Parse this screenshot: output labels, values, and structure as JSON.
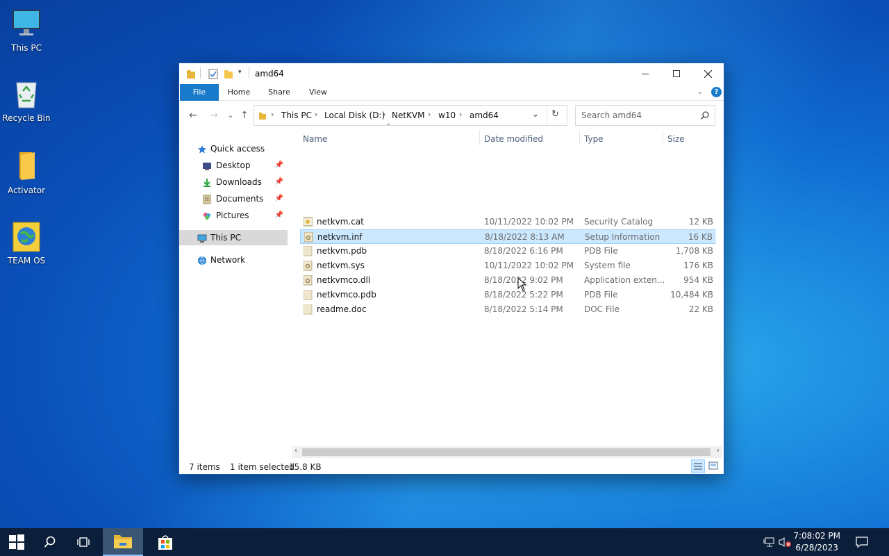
{
  "desktop": {
    "icons": [
      {
        "label": "This PC"
      },
      {
        "label": "Recycle Bin"
      },
      {
        "label": "Activator"
      },
      {
        "label": "TEAM OS"
      }
    ]
  },
  "window": {
    "title": "amd64",
    "ribbon_tabs": [
      "File",
      "Home",
      "Share",
      "View"
    ],
    "breadcrumb": [
      "This PC",
      "Local Disk (D:)",
      "NetKVM",
      "w10",
      "amd64"
    ],
    "search_placeholder": "Search amd64",
    "columns": {
      "name": "Name",
      "date": "Date modified",
      "type": "Type",
      "size": "Size"
    },
    "nav": {
      "quick_access": "Quick access",
      "pinned": [
        "Desktop",
        "Downloads",
        "Documents",
        "Pictures"
      ],
      "this_pc": "This PC",
      "network": "Network"
    },
    "files": [
      {
        "name": "netkvm.cat",
        "date": "10/11/2022 10:02 PM",
        "type": "Security Catalog",
        "size": "12 KB"
      },
      {
        "name": "netkvm.inf",
        "date": "8/18/2022 8:13 AM",
        "type": "Setup Information",
        "size": "16 KB"
      },
      {
        "name": "netkvm.pdb",
        "date": "8/18/2022 6:16 PM",
        "type": "PDB File",
        "size": "1,708 KB"
      },
      {
        "name": "netkvm.sys",
        "date": "10/11/2022 10:02 PM",
        "type": "System file",
        "size": "176 KB"
      },
      {
        "name": "netkvmco.dll",
        "date": "8/18/2022 9:02 PM",
        "type": "Application exten...",
        "size": "954 KB"
      },
      {
        "name": "netkvmco.pdb",
        "date": "8/18/2022 5:22 PM",
        "type": "PDB File",
        "size": "10,484 KB"
      },
      {
        "name": "readme.doc",
        "date": "8/18/2022 5:14 PM",
        "type": "DOC File",
        "size": "22 KB"
      }
    ],
    "status": {
      "count": "7 items",
      "selected": "1 item selected",
      "selsize": "15.8 KB"
    }
  },
  "taskbar": {
    "time": "7:08:02 PM",
    "date": "6/28/2023"
  },
  "colors": {
    "accent": "#1979ca",
    "selection": "#cce8ff",
    "taskbar": "#0b1f3a"
  }
}
